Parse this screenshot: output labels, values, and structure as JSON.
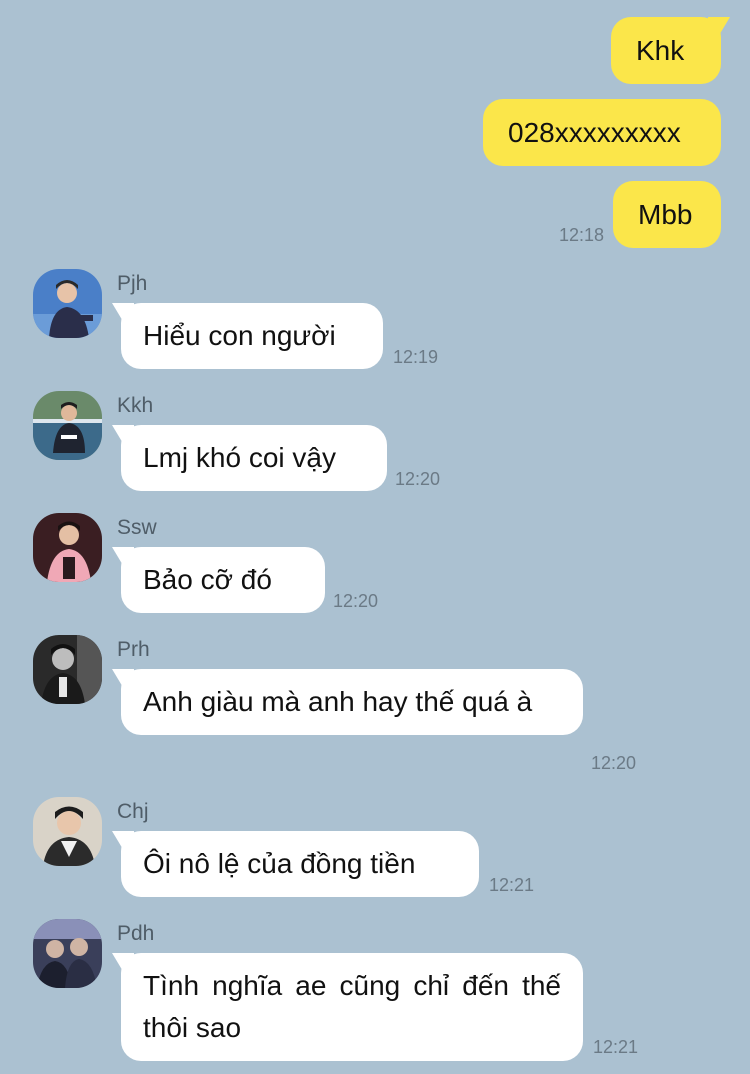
{
  "outgoing": [
    {
      "text": "Khk"
    },
    {
      "text": "028xxxxxxxxx"
    },
    {
      "text": "Mbb",
      "time": "12:18"
    }
  ],
  "incoming": [
    {
      "sender": "Pjh",
      "text": "Hiểu con người",
      "time": "12:19"
    },
    {
      "sender": "Kkh",
      "text": "Lmj khó coi vậy",
      "time": "12:20"
    },
    {
      "sender": "Ssw",
      "text": "Bảo cỡ đó",
      "time": "12:20"
    },
    {
      "sender": "Prh",
      "text": "Anh giàu mà anh hay thế quá à",
      "time": "12:20"
    },
    {
      "sender": "Chj",
      "text": "Ôi nô lệ của đồng tiền",
      "time": "12:21"
    },
    {
      "sender": "Pdh",
      "text": "Tình nghĩa ae cũng chỉ đến thế thôi sao",
      "time": "12:21"
    }
  ],
  "colors": {
    "background": "#abc1d1",
    "outgoing_bubble": "#fbe64a",
    "incoming_bubble": "#ffffff",
    "timestamp": "#6b7a86"
  },
  "icons": {
    "avatar": "profile-photo"
  }
}
